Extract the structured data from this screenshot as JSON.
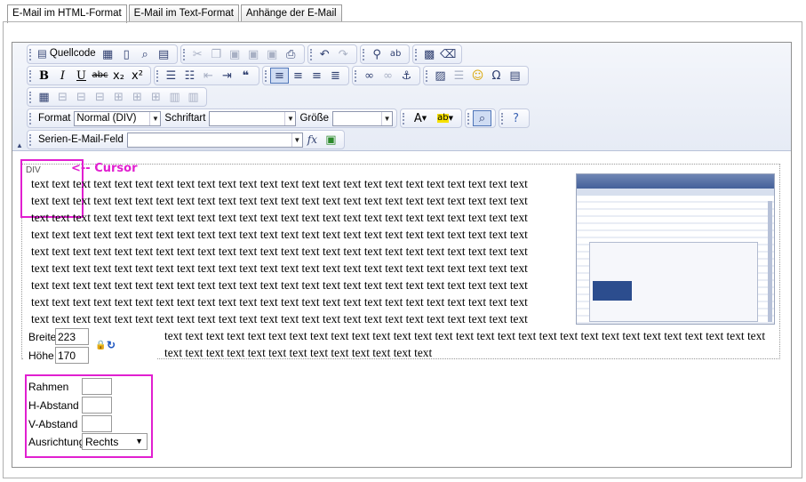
{
  "tabs": [
    {
      "label": "E-Mail im HTML-Format",
      "active": true
    },
    {
      "label": "E-Mail im Text-Format",
      "active": false
    },
    {
      "label": "Anhänge der E-Mail",
      "active": false
    }
  ],
  "toolbar": {
    "source_label": "Quellcode",
    "format_label": "Format",
    "format_value": "Normal (DIV)",
    "font_label": "Schriftart",
    "font_value": "",
    "size_label": "Größe",
    "size_value": "",
    "serial_label": "Serien-E-Mail-Feld",
    "serial_value": "",
    "fx_label": "fx"
  },
  "content": {
    "element_label": "DIV",
    "cursor_annotation": "<-- Cursor",
    "line_text": "text text text text text text text text text text text text text text text text text text text text text text text text",
    "long_line_text": "text text text text text text text text text text text text text text text text text text text text text text text text text text text text text",
    "last_line_text": "text text text text text text text text text text text text text"
  },
  "image_props": {
    "width_label": "Breite",
    "width_value": "223",
    "height_label": "Höhe",
    "height_value": "170",
    "border_label": "Rahmen",
    "border_value": "",
    "hspace_label": "H-Abstand",
    "hspace_value": "",
    "vspace_label": "V-Abstand",
    "vspace_value": "",
    "align_label": "Ausrichtung",
    "align_value": "Rechts"
  },
  "colors": {
    "highlight": "#e11fd0",
    "toolbar_bg": "#e6ebf5"
  }
}
